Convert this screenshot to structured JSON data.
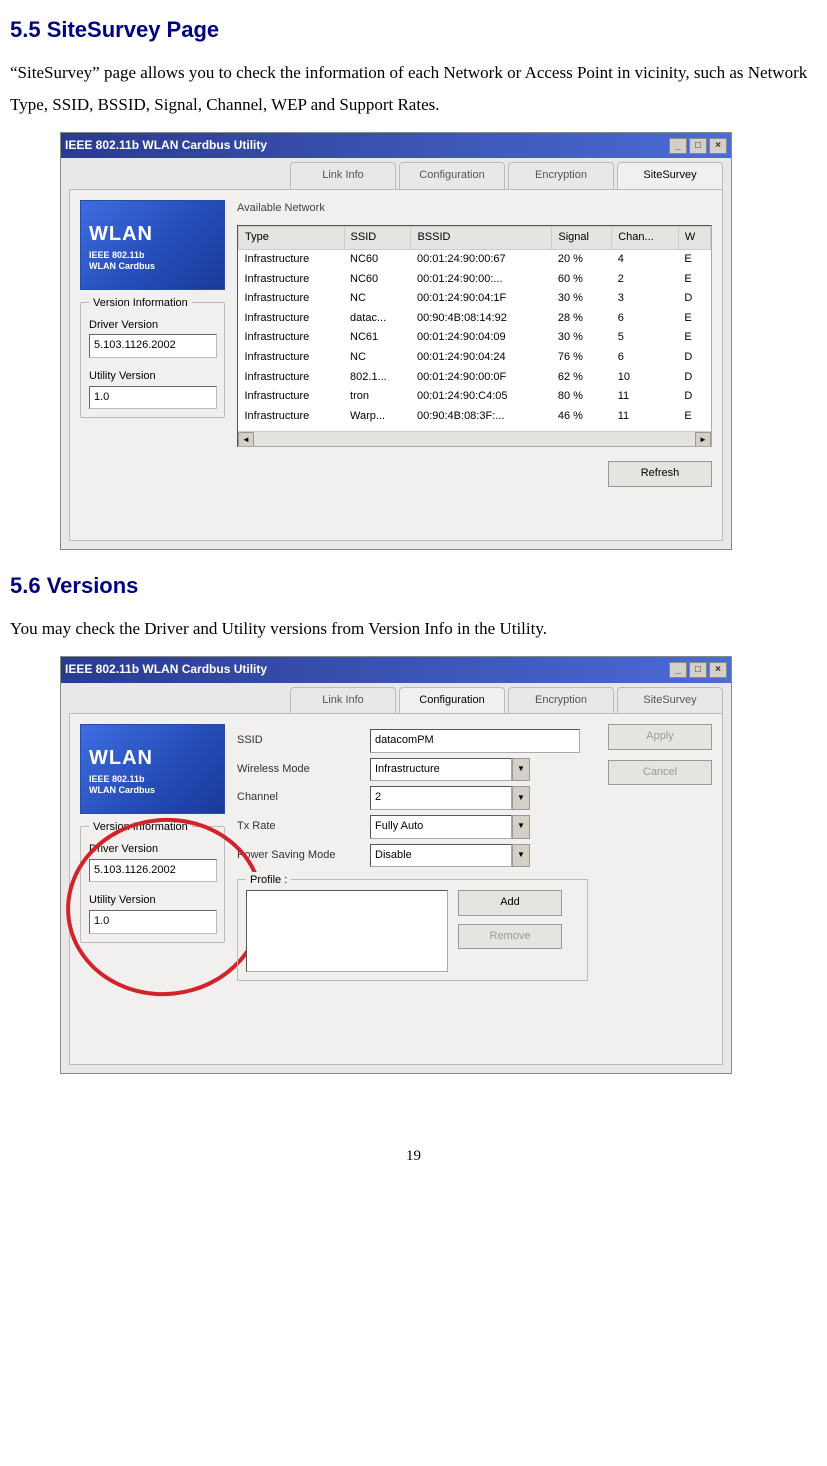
{
  "section1": {
    "heading": "5.5 SiteSurvey Page",
    "paragraph": "“SiteSurvey” page allows you to check the information of each Network or Access Point in vicinity, such as Network Type, SSID, BSSID, Signal, Channel, WEP and Support Rates."
  },
  "section2": {
    "heading": "5.6 Versions",
    "paragraph": "You may check the Driver and Utility versions from Version Info in the Utility."
  },
  "page_number": "19",
  "window_title": "IEEE 802.11b WLAN Cardbus Utility",
  "logo": {
    "big": "WLAN",
    "line1": "IEEE 802.11b",
    "line2": "WLAN Cardbus"
  },
  "tabs": {
    "linkinfo": "Link Info",
    "configuration": "Configuration",
    "encryption": "Encryption",
    "sitesurvey": "SiteSurvey"
  },
  "version_box": {
    "title": "Version Information",
    "driver_label": "Driver Version",
    "driver_value": "5.103.1126.2002",
    "utility_label": "Utility Version",
    "utility_value": "1.0"
  },
  "sitesurvey": {
    "available_label": "Available Network",
    "refresh": "Refresh",
    "columns": [
      "Type",
      "SSID",
      "BSSID",
      "Signal",
      "Chan...",
      "W"
    ],
    "rows": [
      [
        "Infrastructure",
        "NC60",
        "00:01:24:90:00:67",
        "20 %",
        "4",
        "E"
      ],
      [
        "Infrastructure",
        "NC60",
        "00:01:24:90:00:...",
        "60 %",
        "2",
        "E"
      ],
      [
        "Infrastructure",
        "NC",
        "00:01:24:90:04:1F",
        "30 %",
        "3",
        "D"
      ],
      [
        "Infrastructure",
        "datac...",
        "00:90:4B:08:14:92",
        "28 %",
        "6",
        "E"
      ],
      [
        "Infrastructure",
        "NC61",
        "00:01:24:90:04:09",
        "30 %",
        "5",
        "E"
      ],
      [
        "Infrastructure",
        "NC",
        "00:01:24:90:04:24",
        "76 %",
        "6",
        "D"
      ],
      [
        "Infrastructure",
        "802.1...",
        "00:01:24:90:00:0F",
        "62 %",
        "10",
        "D"
      ],
      [
        "Infrastructure",
        "tron",
        "00:01:24:90:C4:05",
        "80 %",
        "11",
        "D"
      ],
      [
        "Infrastructure",
        "Warp...",
        "00:90:4B:08:3F:...",
        "46 %",
        "11",
        "E"
      ]
    ]
  },
  "config": {
    "ssid_label": "SSID",
    "ssid_value": "datacomPM",
    "wireless_label": "Wireless Mode",
    "wireless_value": "Infrastructure",
    "channel_label": "Channel",
    "channel_value": "2",
    "txrate_label": "Tx Rate",
    "txrate_value": "Fully Auto",
    "psm_label": "Power Saving Mode",
    "psm_value": "Disable",
    "apply": "Apply",
    "cancel": "Cancel",
    "profile_title": "Profile :",
    "add": "Add",
    "remove": "Remove"
  }
}
